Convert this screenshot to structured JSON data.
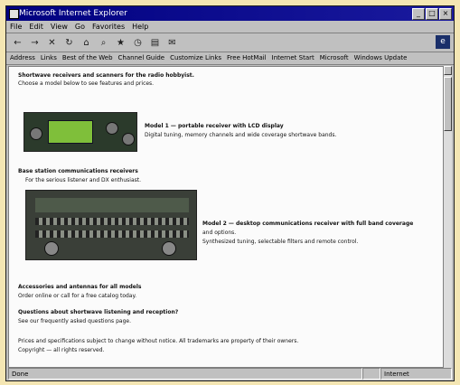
{
  "window": {
    "title": "Microsoft Internet Explorer",
    "controls": [
      "_",
      "□",
      "×"
    ]
  },
  "menu": [
    "File",
    "Edit",
    "View",
    "Go",
    "Favorites",
    "Help"
  ],
  "toolbar": {
    "buttons": [
      "back-icon",
      "forward-icon",
      "stop-icon",
      "refresh-icon",
      "home-icon",
      "search-icon",
      "favorites-icon",
      "history-icon",
      "print-icon",
      "mail-icon"
    ]
  },
  "links": {
    "address_label": "Address",
    "items": [
      "Links",
      "Best of the Web",
      "Channel Guide",
      "Customize Links",
      "Free HotMail",
      "Internet Start",
      "Microsoft",
      "Windows Update"
    ]
  },
  "page": {
    "intro_line1": "Shortwave receivers and scanners for the radio hobbyist.",
    "intro_line2": "Choose a model below to see features and prices.",
    "item1_title": "Model 1 — portable receiver with LCD display",
    "item1_desc": "Digital tuning, memory channels and wide coverage shortwave bands.",
    "section2_title": "Base station communications receivers",
    "section2_sub": "For the serious listener and DX enthusiast.",
    "item2_title": "Model 2 — desktop communications receiver with full band coverage",
    "item2_desc1": "and options.",
    "item2_desc2": "Synthesized tuning, selectable filters and remote control.",
    "footer1a": "Accessories and antennas for all models",
    "footer1b": "Order online or call for a free catalog today.",
    "footer2a": "Questions about shortwave listening and reception?",
    "footer2b": "See our frequently asked questions page.",
    "footer3a": "Prices and specifications subject to change without notice. All trademarks are property of their owners.",
    "footer3b": "Copyright — all rights reserved."
  },
  "status": {
    "text": "Done",
    "zone": "Internet"
  }
}
